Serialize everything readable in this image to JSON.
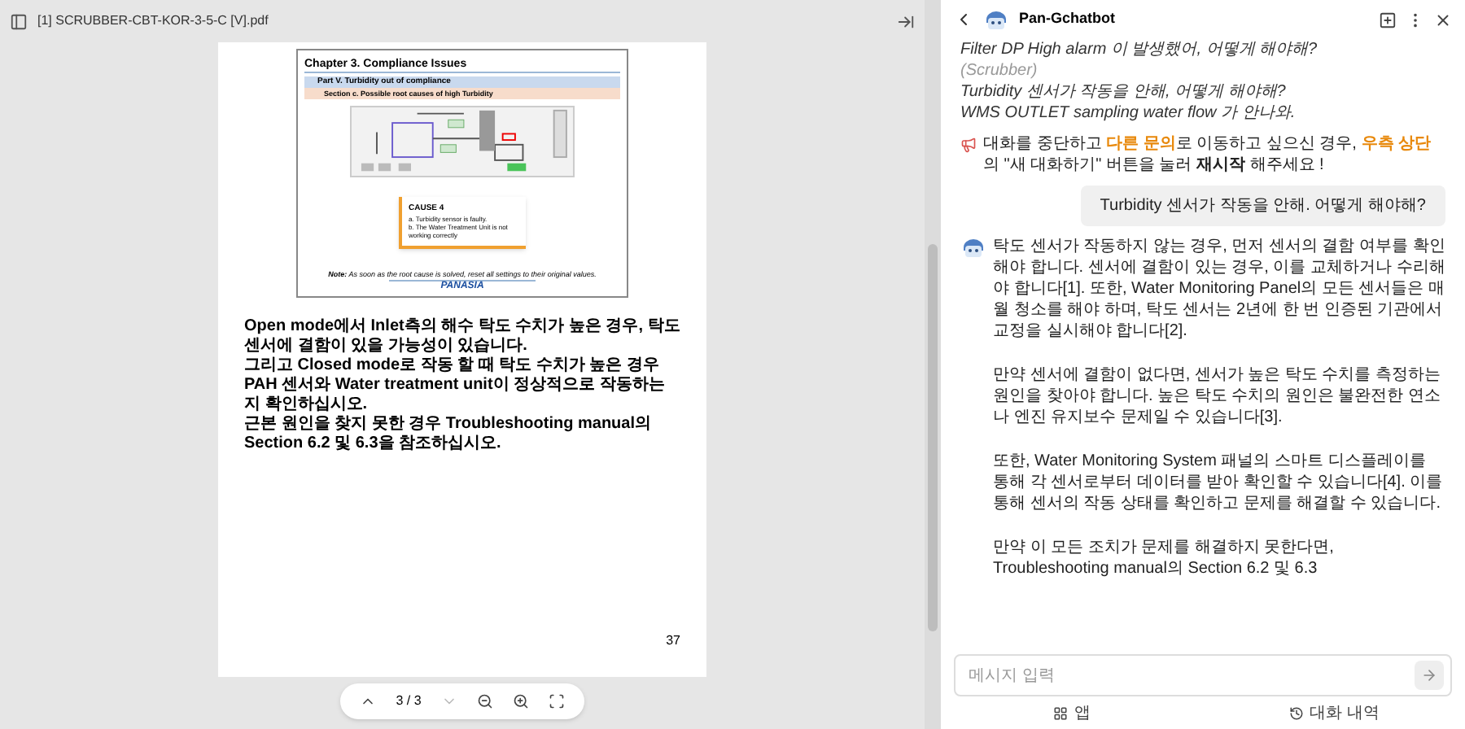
{
  "viewer": {
    "file_name": "[1] SCRUBBER-CBT-KOR-3-5-C [V].pdf",
    "slide": {
      "chapter": "Chapter 3. Compliance Issues",
      "part": "Part V. Turbidity out of compliance",
      "section": "Section c. Possible root causes of high Turbidity",
      "cause_title": "CAUSE 4",
      "cause_items": [
        "a.  Turbidity sensor is faulty.",
        "b.  The Water Treatment Unit is not working correctly"
      ],
      "note_label": "Note:",
      "note": "As soon as the root cause is solved, reset all settings to their original values.",
      "logo": "PANASIA"
    },
    "body": [
      "Open mode에서 Inlet측의 해수 탁도 수치가 높은 경우, 탁도 센서에 결함이 있을 가능성이 있습니다.",
      "그리고 Closed mode로 작동 할 때 탁도 수치가 높은 경우 PAH 센서와 Water treatment unit이 정상적으로 작동하는지 확인하십시오.",
      "근본 원인을 찾지 못한 경우 Troubleshooting manual의 Section 6.2 및 6.3을 참조하십시오."
    ],
    "page_number": "37",
    "toolbar": {
      "page": "3 / 3",
      "prev_disabled": false,
      "next_disabled": true
    }
  },
  "chat": {
    "title": "Pan-Gchatbot",
    "examples": [
      {
        "kind": "question",
        "text": "Filter DP High alarm 이 발생했어, 어떻게 해야해?"
      },
      {
        "kind": "category",
        "text": "(Scrubber)"
      },
      {
        "kind": "question",
        "text": "Turbidity 센서가 작동을 안해, 어떻게 해야해?"
      },
      {
        "kind": "question",
        "text": "WMS OUTLET sampling water flow 가 안나와."
      }
    ],
    "notice": [
      {
        "kind": "plain",
        "text": "대화를 중단하고 "
      },
      {
        "kind": "highlight",
        "text": "다른 문의"
      },
      {
        "kind": "plain",
        "text": "로 이동하고 싶으신 경우, "
      },
      {
        "kind": "highlight",
        "text": "우측 상단"
      },
      {
        "kind": "plain",
        "text": "의 \"새 대화하기\" 버튼을 눌러 "
      },
      {
        "kind": "bold",
        "text": "재시작"
      },
      {
        "kind": "plain",
        "text": " 해주세요 !"
      }
    ],
    "messages": [
      {
        "kind": "user",
        "paragraphs": [
          "Turbidity 센서가 작동을 안해. 어떻게 해야해?"
        ]
      },
      {
        "kind": "bot",
        "paragraphs": [
          "탁도 센서가 작동하지 않는 경우, 먼저 센서의 결함 여부를 확인해야 합니다. 센서에 결함이 있는 경우, 이를 교체하거나 수리해야 합니다[1]. 또한, Water Monitoring Panel의 모든 센서들은 매월 청소를 해야 하며, 탁도 센서는 2년에 한 번 인증된 기관에서 교정을 실시해야 합니다[2].",
          "만약 센서에 결함이 없다면, 센서가 높은 탁도 수치를 측정하는 원인을 찾아야 합니다. 높은 탁도 수치의 원인은 불완전한 연소나 엔진 유지보수 문제일 수 있습니다[3].",
          "또한, Water Monitoring System 패널의 스마트 디스플레이를 통해 각 센서로부터 데이터를 받아 확인할 수 있습니다[4]. 이를 통해 센서의 작동 상태를 확인하고 문제를 해결할 수 있습니다.",
          "만약 이 모든 조치가 문제를 해결하지 못한다면, Troubleshooting manual의 Section 6.2 및 6.3"
        ]
      }
    ],
    "input": {
      "placeholder": "메시지 입력"
    },
    "footer": [
      {
        "label": "앱",
        "selected": false
      },
      {
        "label": "대화 내역",
        "selected": false
      }
    ]
  }
}
